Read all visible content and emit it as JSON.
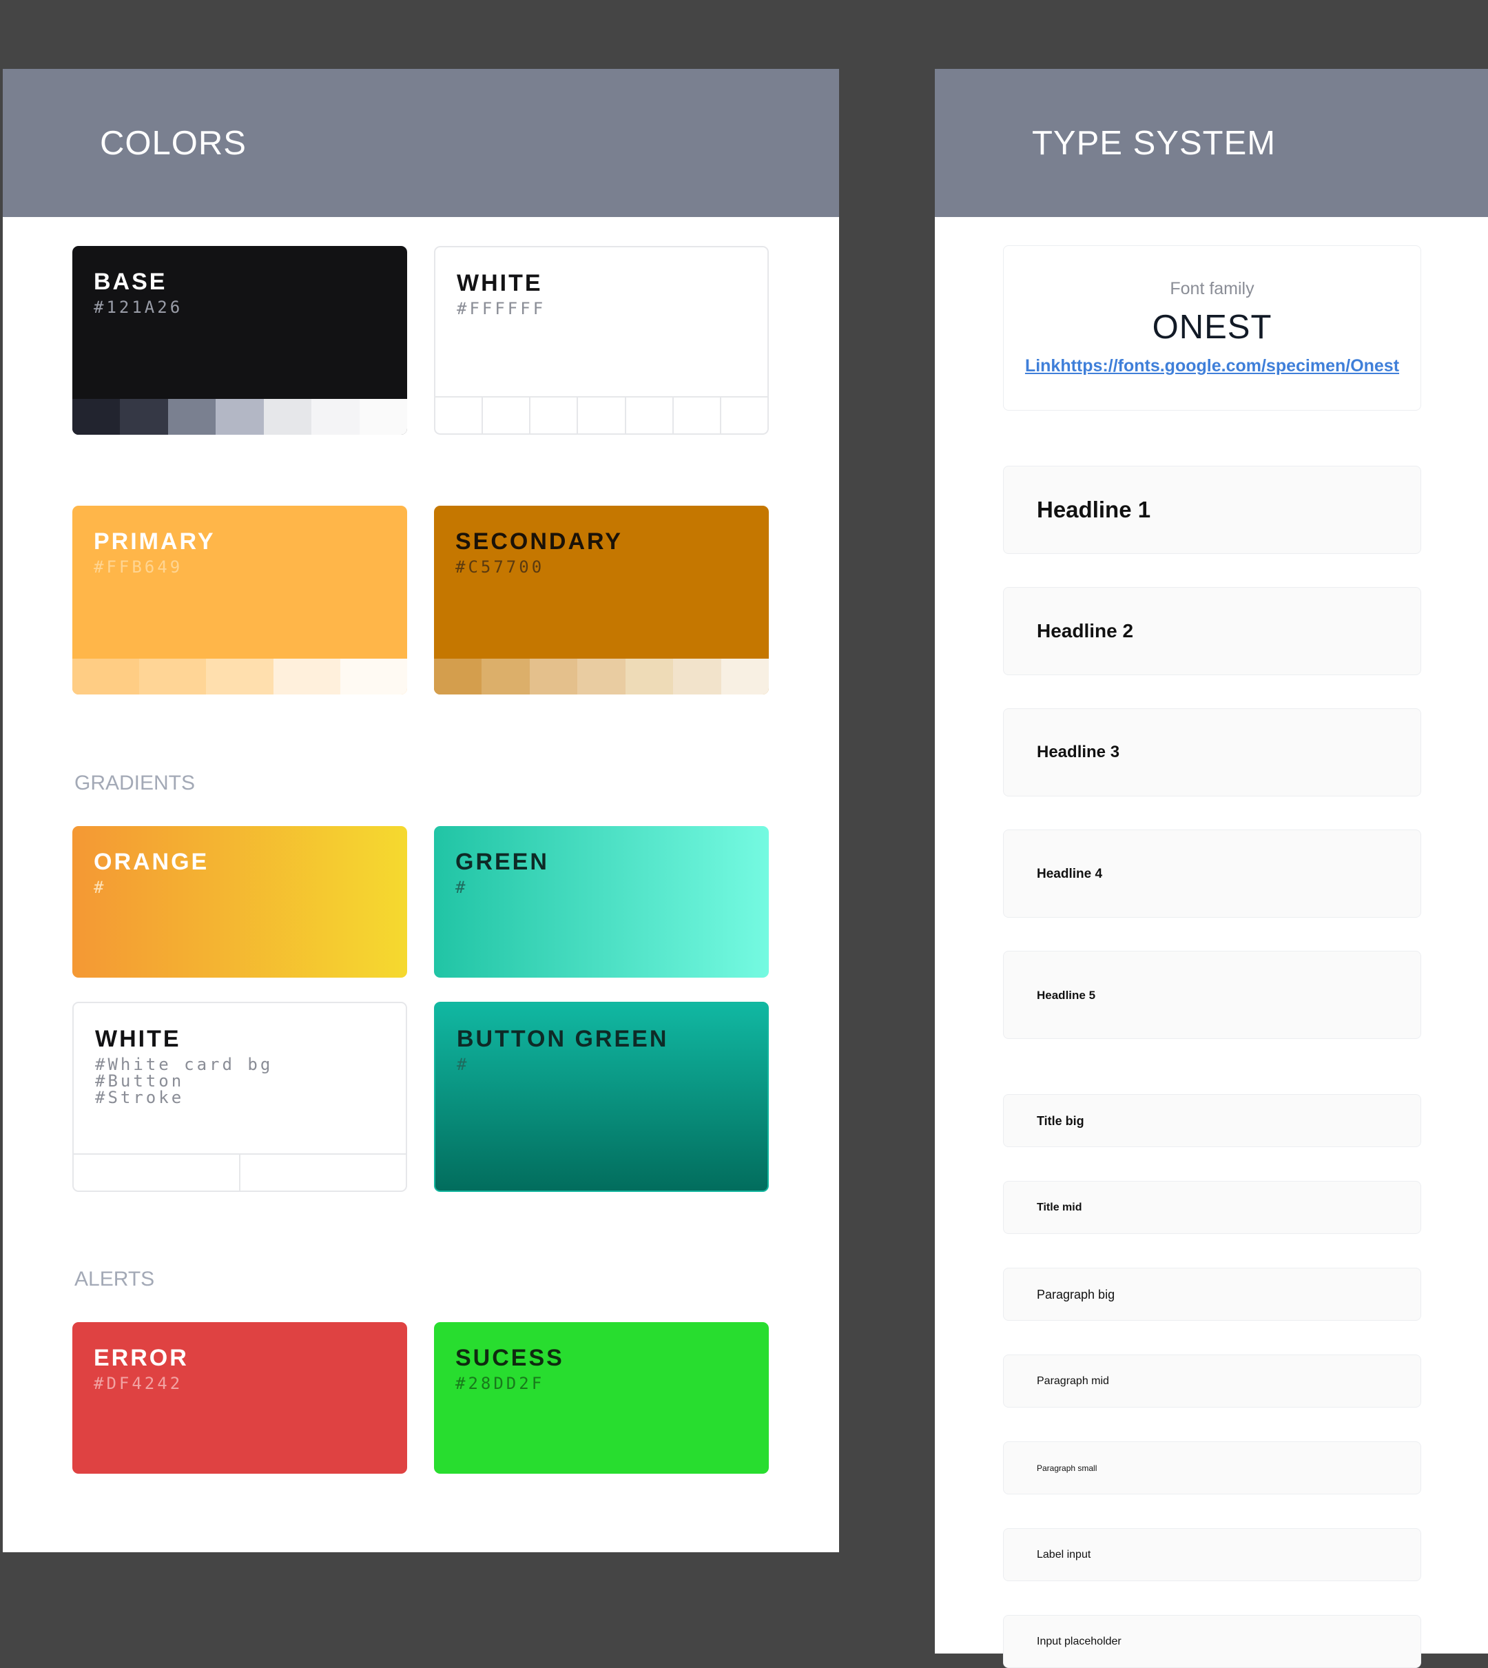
{
  "colors_panel": {
    "title": "COLORS",
    "cards": {
      "base": {
        "name": "BASE",
        "code": "#121A26",
        "bg": "#121214",
        "strip": [
          "#22242f",
          "#353845",
          "#7a8090",
          "#b3b7c5",
          "#e6e7ea",
          "#f4f4f6",
          "#fafafa"
        ]
      },
      "white": {
        "name": "WHITE",
        "code": "#FFFFFF",
        "bg": "#ffffff",
        "strip": [
          "#ffffff",
          "#ffffff",
          "#ffffff",
          "#ffffff",
          "#ffffff",
          "#ffffff",
          "#ffffff"
        ]
      },
      "primary": {
        "name": "PRIMARY",
        "code": "#FFB649",
        "bg": "#ffb649",
        "strip": [
          "#ffcd84",
          "#ffd596",
          "#ffdfae",
          "#fff0dc",
          "#fffaf3"
        ]
      },
      "secondary": {
        "name": "SECONDARY",
        "code": "#C57700",
        "bg": "#c57700",
        "strip": [
          "#d49e4d",
          "#dcaf6a",
          "#e4c08c",
          "#e9cca1",
          "#eedbb7",
          "#f2e3cb",
          "#f8f0e3"
        ]
      }
    },
    "gradients_label": "GRADIENTS",
    "gradients": {
      "orange": {
        "name": "ORANGE",
        "code": "#",
        "from": "#f49834",
        "to": "#f5d92f"
      },
      "green": {
        "name": "GREEN",
        "code": "#",
        "from": "#21c4a5",
        "to": "#75fae1"
      },
      "white_card": {
        "name": "WHITE",
        "lines": [
          "#White card bg",
          "#Button",
          "#Stroke"
        ]
      },
      "button_green": {
        "name": "BUTTON GREEN",
        "code": "#",
        "from": "#11b8a2",
        "to": "#026d5d"
      }
    },
    "alerts_label": "ALERTS",
    "alerts": {
      "error": {
        "name": "ERROR",
        "code": "#DF4242",
        "bg": "#df4242"
      },
      "success": {
        "name": "SUCESS",
        "code": "#28DD2F",
        "bg": "#28dd2f"
      }
    }
  },
  "type_panel": {
    "title": "TYPE SYSTEM",
    "font_family_label": "Font family",
    "font_name": "ONEST",
    "font_link": "Linkhttps://fonts.google.com/specimen/Onest",
    "styles": [
      "Headline 1",
      "Headline 2",
      "Headline 3",
      "Headline 4",
      "Headline 5",
      "Title big",
      "Title mid",
      "Paragraph big",
      "Paragraph mid",
      "Paragraph small",
      "Label input",
      "Input placeholder"
    ]
  }
}
